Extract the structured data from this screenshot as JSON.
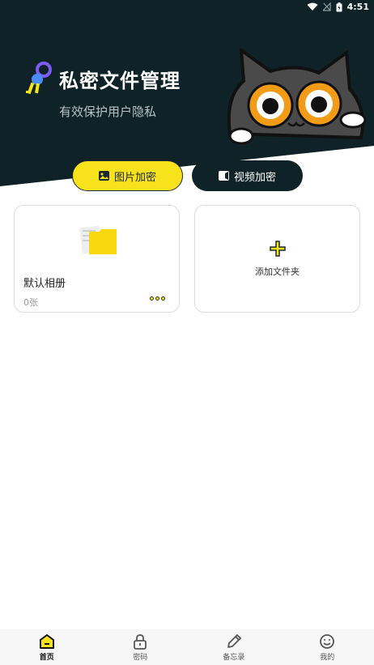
{
  "status_bar": {
    "time": "4:51"
  },
  "header": {
    "title": "私密文件管理",
    "subtitle": "有效保护用户隐私"
  },
  "tabs": [
    {
      "label": "图片加密",
      "icon": "image-icon",
      "active": true
    },
    {
      "label": "视频加密",
      "icon": "video-icon",
      "active": false
    }
  ],
  "albums": [
    {
      "name": "默认相册",
      "count": "0张"
    }
  ],
  "add_folder": {
    "label": "添加文件夹"
  },
  "bottom_nav": [
    {
      "label": "首页",
      "icon": "home-icon",
      "active": true
    },
    {
      "label": "密码",
      "icon": "lock-icon",
      "active": false
    },
    {
      "label": "备忘录",
      "icon": "pencil-icon",
      "active": false
    },
    {
      "label": "我的",
      "icon": "smiley-icon",
      "active": false
    }
  ],
  "colors": {
    "header": "#0f2227",
    "accent": "#f8e21c"
  }
}
